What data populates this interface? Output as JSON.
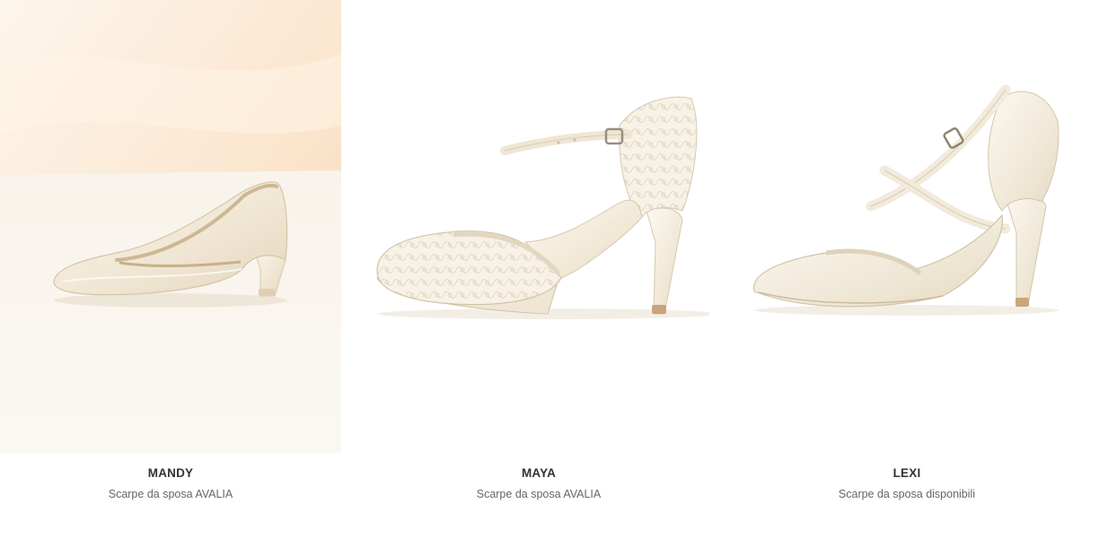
{
  "products": [
    {
      "name": "MANDY",
      "subtitle": "Scarpe da sposa AVALIA",
      "image_icon": "court-pump-shoe-icon"
    },
    {
      "name": "MAYA",
      "subtitle": "Scarpe da sposa AVALIA",
      "image_icon": "ankle-strap-lace-shoe-icon"
    },
    {
      "name": "LEXI",
      "subtitle": "Scarpe da sposa disponibili",
      "image_icon": "cross-strap-shoe-icon"
    }
  ],
  "colors": {
    "title": "#333333",
    "subtitle": "#666666",
    "ivory": "#f3ecdf",
    "background_peach": "#fbe9d6"
  }
}
